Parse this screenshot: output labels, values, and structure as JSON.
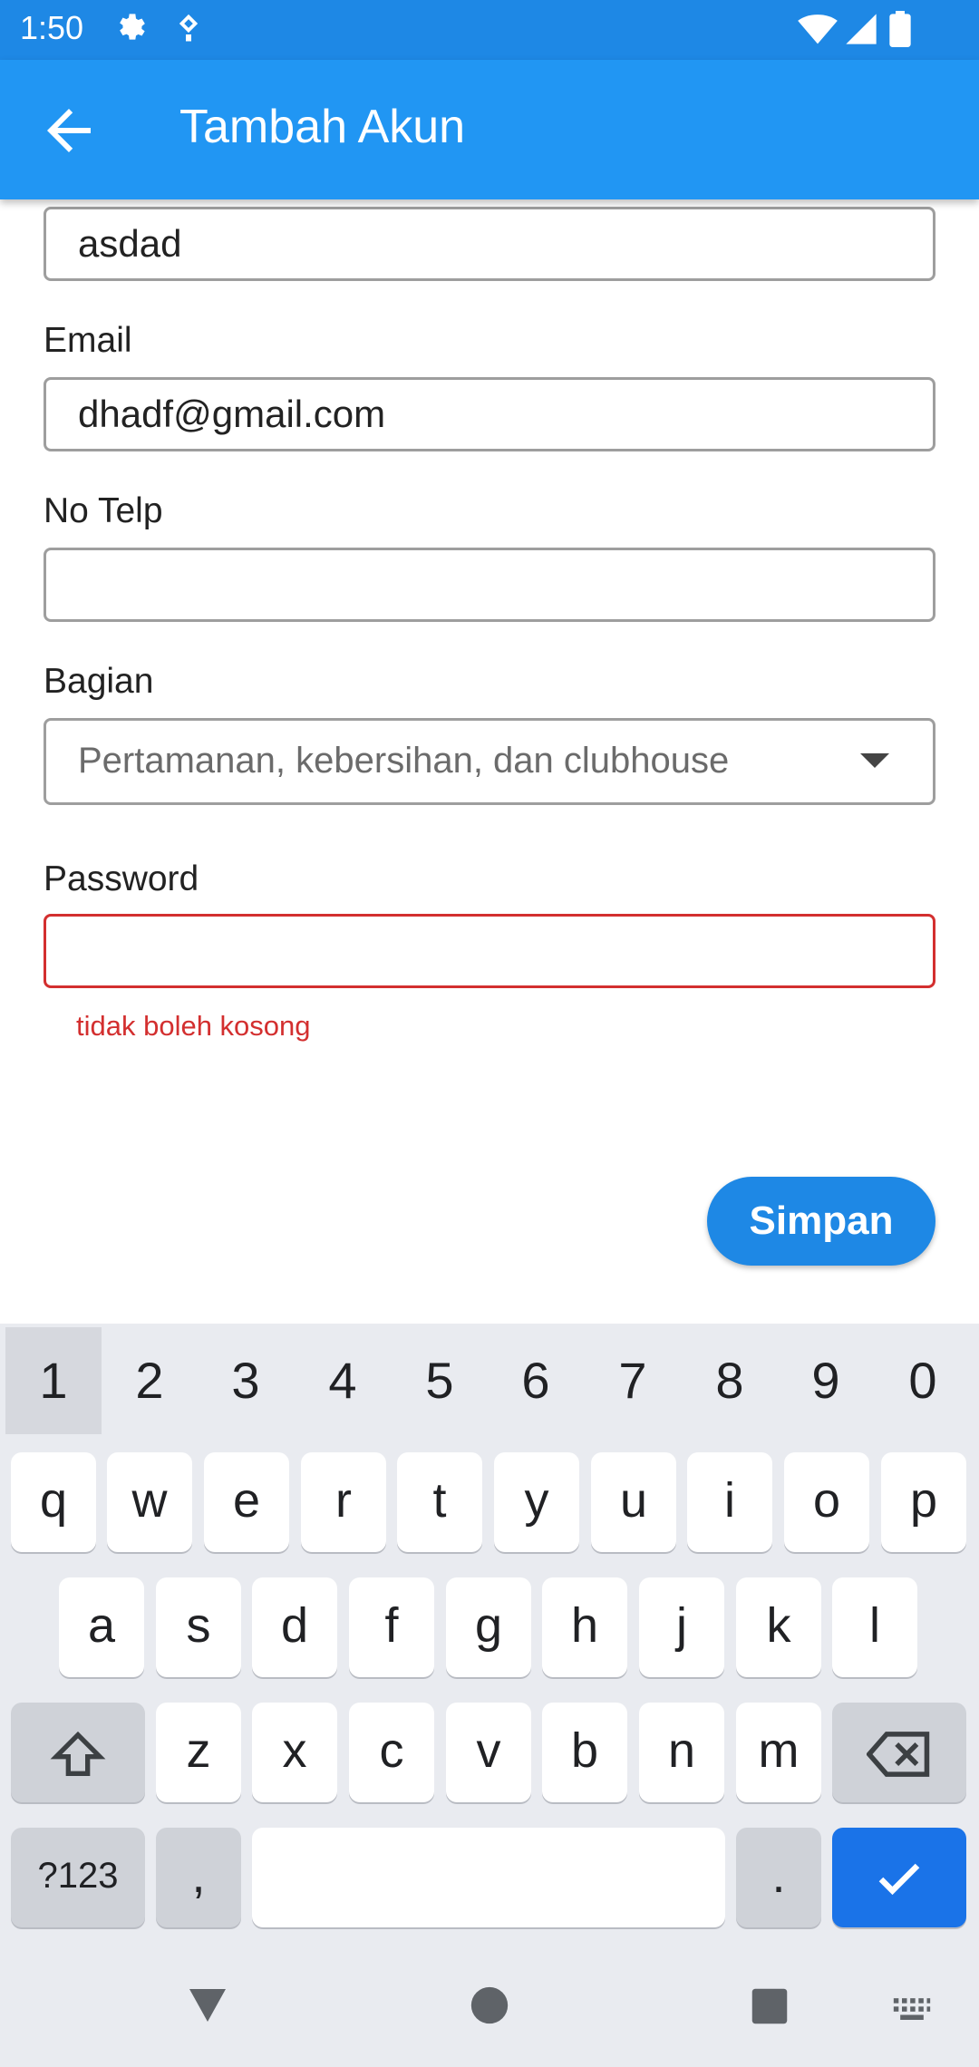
{
  "status": {
    "time": "1:50"
  },
  "appbar": {
    "title": "Tambah Akun"
  },
  "form": {
    "name_value": "asdad",
    "email_label": "Email",
    "email_value": "dhadf@gmail.com",
    "phone_label": "No Telp",
    "phone_value": "",
    "bagian_label": "Bagian",
    "bagian_value": "Pertamanan, kebersihan, dan clubhouse",
    "password_label": "Password",
    "password_value": "",
    "password_error": "tidak boleh kosong",
    "save_label": "Simpan"
  },
  "keyboard": {
    "numbers": [
      "1",
      "2",
      "3",
      "4",
      "5",
      "6",
      "7",
      "8",
      "9",
      "0"
    ],
    "row1": [
      "q",
      "w",
      "e",
      "r",
      "t",
      "y",
      "u",
      "i",
      "o",
      "p"
    ],
    "row2": [
      "a",
      "s",
      "d",
      "f",
      "g",
      "h",
      "j",
      "k",
      "l"
    ],
    "row3": [
      "z",
      "x",
      "c",
      "v",
      "b",
      "n",
      "m"
    ],
    "symbols_label": "?123",
    "comma_label": ",",
    "period_label": "."
  },
  "colors": {
    "primary": "#2196f3",
    "statusbar": "#1e88e5",
    "error": "#d32f2f",
    "enter_key": "#1a73e8"
  },
  "icons": [
    "settings-icon",
    "location-icon",
    "wifi-icon",
    "signal-icon",
    "battery-icon",
    "back-arrow-icon",
    "dropdown-caret-icon",
    "shift-icon",
    "backspace-icon",
    "check-icon",
    "nav-back-icon",
    "nav-home-icon",
    "nav-recents-icon",
    "keyboard-switch-icon"
  ]
}
